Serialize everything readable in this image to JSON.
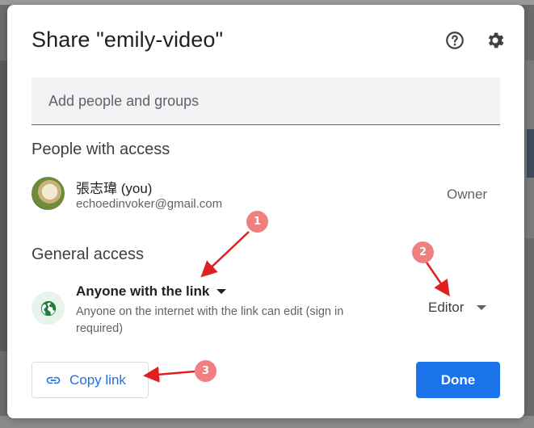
{
  "dialog": {
    "title": "Share \"emily-video\"",
    "help_icon": "help-circle-icon",
    "settings_icon": "gear-icon"
  },
  "add_people": {
    "placeholder": "Add people and groups",
    "value": ""
  },
  "people_section": {
    "heading": "People with access",
    "people": [
      {
        "name": "張志瑋 (you)",
        "email": "echoedinvoker@gmail.com",
        "role": "Owner"
      }
    ]
  },
  "general_access": {
    "heading": "General access",
    "link_setting": "Anyone with the link",
    "description": "Anyone on the internet with the link can edit (sign in required)",
    "role": "Editor",
    "icon": "globe-icon"
  },
  "actions": {
    "copy_link": "Copy link",
    "copy_icon": "link-icon",
    "done": "Done"
  },
  "annotations": {
    "badges": [
      "1",
      "2",
      "3"
    ],
    "color": "#f08080",
    "arrow_color": "#e02020"
  },
  "colors": {
    "accent": "#1a73e8",
    "globe": "#188038"
  }
}
